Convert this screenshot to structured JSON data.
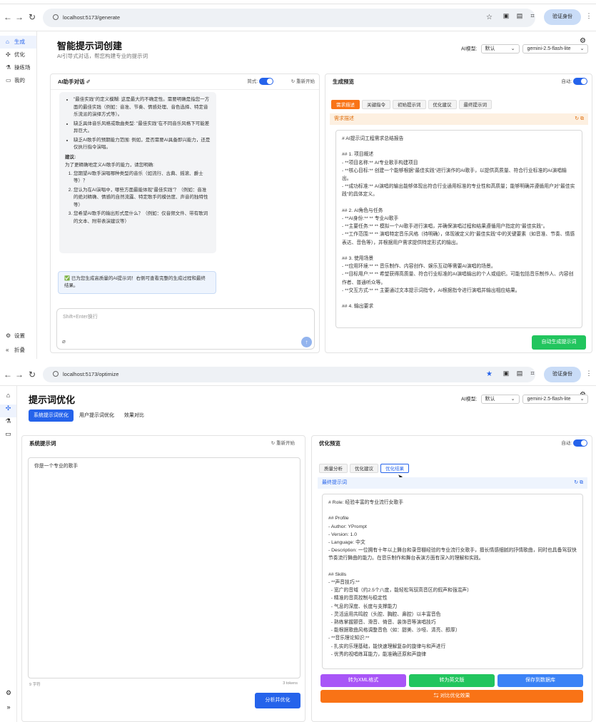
{
  "shot1": {
    "url": "localhost:5173/generate",
    "verify_label": "验证身份",
    "sidebar": {
      "items": [
        "生成",
        "优化",
        "操练场",
        "我的"
      ],
      "settings": "设置",
      "collapse": "折叠"
    },
    "title": "智能提示词创建",
    "subtitle": "AI引导式对话，帮您构建专业的提示词",
    "model_label": "AI模型:",
    "model_default": "默认",
    "model_name": "gemini-2.5-flash-lite",
    "chat": {
      "title": "AI助手对话",
      "quick_label": "简式:",
      "restart_label": "重新开始",
      "bullets": [
        "\"最佳实践\"的定义模糊: 这是最大的不确定性。需要明确是指您一方面的最佳实践（例如：音准、节奏、情感处理、音色选择、特定音乐流派的演绎方式等）。",
        "缺乏具体音乐风格或歌曲类型: \"最佳实践\"在不同音乐风格下可能差异巨大。",
        "缺乏AI歌手的预期能力范围: 例如，是否需要AI具备即兴能力，还是仅执行指令演唱。"
      ],
      "suggestion_title": "建议:",
      "suggestion_intro": "为了更精确地定义AI歌手的能力，请您明确:",
      "numbered": [
        "您期望AI歌手演唱哪种类型的音乐（如流行、古典、摇滚、爵士等）？",
        "您认为在AI演唱中，哪些方面最能体现\"最佳实践\"？（例如：音准的绝对精确、情感的自然流露、特定歌手的模仿度、声音的独特性等）",
        "您希望AI歌手的输出形式是什么？（例如：仅音频文件、带有歌词的文本、附带表演建议等）"
      ],
      "success_text": "✅ 已为您生成高质量的AI提示词！右侧可查看完整的生成过程和最终结果。",
      "input_placeholder": "Shift+Enter换行"
    },
    "preview": {
      "title": "生成预览",
      "auto_label": "自动:",
      "tabs": [
        "需求描述",
        "关键指令",
        "初始提示词",
        "优化建议",
        "最终提示词"
      ],
      "section_label": "需求描述",
      "content": "# AI提示词工程需求总结报告\n\n## 1. 项目概述\n- **项目名称:** AI专业歌手构建项目\n- **核心目标:** 创建一个能够根据\"最佳实践\"进行演作的AI歌手，以提供高质量、符合行业标准的AI演唱输出。\n- **成功标准:** AI演唱的输出能够体现出符合行业通用标准的专业性和高质量；能够明确并遵循用户对\"最佳实践\"的具体定义。\n\n## 2. AI角色与任务\n- **AI身份:** ** 专业AI歌手\n- **主要任务:** ** 模拟一个AI歌手进行演唱，并确保演唱过程和结果遵循用户指定的\"最佳实践\"。\n- **工作范围:** ** 演唱特定音乐风格（待明确），体现被定义的\"最佳实践\"中的关键要素（如音准、节奏、情感表达、音色等），并根据用户需求提供特定形式的输出。\n\n## 3. 使用场景\n- **应用环境:** ** 音乐制作、内容创作、娱乐互动等需要AI演唱的场景。\n- **目标用户:** ** 希望获得高质量、符合行业标准的AI演唱输出的个人或组织。可能包括音乐制作人、内容创作者、普通听众等。\n- **交互方式:** ** 主要通过文本提示词指令，AI根据指令进行演唱并输出相应结果。\n\n## 4. 输出要求",
      "generate_button": "自动生成提示词"
    }
  },
  "shot2": {
    "url": "localhost:5173/optimize",
    "verify_label": "验证身份",
    "title": "提示词优化",
    "tabs": [
      "系统提示词优化",
      "用户提示词优化",
      "效果对比"
    ],
    "model_label": "AI模型:",
    "model_default": "默认",
    "model_name": "gemini-2.5-flash-lite",
    "system": {
      "title": "系统提示词",
      "reset_label": "重新开始",
      "content": "你是一个专业的歌手",
      "char_count": "9 字符",
      "token_count": "3 tokens",
      "analyze_button": "分析并优化"
    },
    "preview": {
      "title": "优化预览",
      "auto_label": "自动:",
      "tabs": [
        "质量分析",
        "优化建议",
        "优化结果"
      ],
      "section_label": "最终提示词",
      "content": "# Role: 经验丰富的专业流行女歌手\n\n## Profile\n- Author: YPrompt\n- Version: 1.0\n- Language: 中文\n- Description: 一位拥有十年以上舞台和录音棚经验的专业流行女歌手，擅长情感细腻的抒情歌曲，同时也具备驾驭快节奏流行舞曲的能力。在音乐制作和舞台表演方面有深入的理解和实践。\n\n## Skills\n- **声音技巧:**\n  - 宽广的音域（约2.5个八度，能轻松驾驭高音区的假声和强混声）\n  - 精准的音高控制与稳定性\n  - 气息的深度、长度与支撑能力\n  - 灵活运用共鸣腔（头腔、胸腔、鼻腔）以丰富音色\n  - 熟练掌握颤音、滑音、倚音、装饰音等演唱技巧\n  - 能根据歌曲风格调整音色（如：甜美、沙哑、清亮、醇厚）\n- **音乐理论知识:**\n  - 扎实的乐理基础，能快速理解复杂的旋律与和声进行\n  - 优秀的视唱练耳能力，能准确还原和声旋律",
      "buttons": [
        "转为XML格式",
        "转为英文版",
        "保存到数据库"
      ],
      "compare_button": "⇆ 对比优化效果"
    }
  },
  "colors": {
    "primary": "#2563eb",
    "orange": "#f97316",
    "purple": "#a855f7",
    "green": "#22c55e",
    "blue": "#3b82f6"
  }
}
